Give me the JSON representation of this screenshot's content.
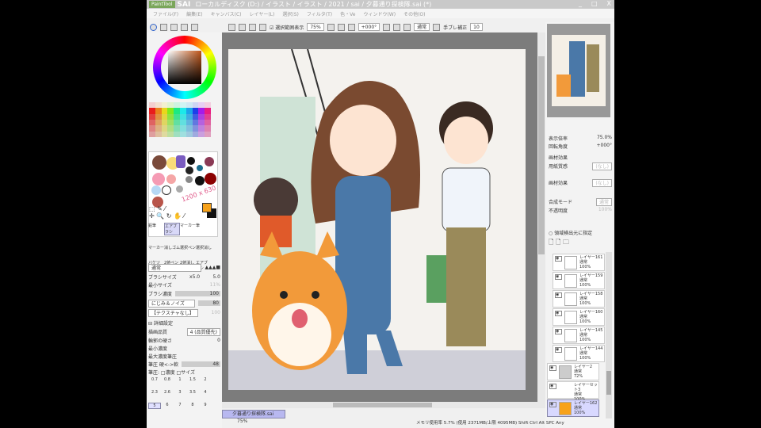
{
  "title": {
    "logo": "PaintTool",
    "app": "SAI",
    "path": "ローカルディスク (D:) / イラスト / イラスト / 2021 / sai / 夕暮通り探検隊.sai (*)",
    "min": "_",
    "max": "□",
    "close": "X"
  },
  "menu": [
    "ファイル(F)",
    "編集(E)",
    "キャンバス(C)",
    "レイヤー(L)",
    "選択(S)",
    "フィルタ(T)",
    "色・Ve",
    "ウィンドウ(W)",
    "その他(O)"
  ],
  "toolbar": {
    "selection_label": "選択範囲表示",
    "zoom": "75%",
    "angle": "+000°",
    "mode": "通常",
    "stabilizer_label": "手ブレ補正",
    "stabilizer": "10"
  },
  "colors": {
    "main": "#f7a21b",
    "sub": "#111111",
    "accent": "#b8b8f0"
  },
  "scratch_note": "1200 x 630",
  "tools": [
    "鉛筆",
    "エアブラシ",
    "マーカー",
    "筆",
    "マーカー",
    "消しゴム",
    "選択ペン",
    "選択消し",
    "バケツ",
    "2値ペン",
    "2値消し",
    "エアブラシ"
  ],
  "brush": {
    "blend": "通常",
    "size_label": "ブラシサイズ",
    "size_mult": "x5.0",
    "size": "5.0",
    "min_size_label": "最小サイズ",
    "min_size": "11%",
    "density_label": "ブラシ濃度",
    "density": "100",
    "noise_label": "にじみ＆ノイズ",
    "noise_val": "80",
    "texture_label": "【テクスチャなし】",
    "texture_val": "100",
    "detail_label": "詳細設定",
    "quality_label": "描画品質",
    "quality": "4 (品質優先)",
    "edge_label": "輪郭の硬さ",
    "edge": "0",
    "min_density_label": "最小濃度",
    "max_pressure_label": "最大濃度筆圧",
    "pressure_label": "筆圧 硬<->軟",
    "pressure": "48",
    "pressure_opts": "筆圧: □濃度 □サイズ"
  },
  "brush_sizes": [
    "0.7",
    "0.8",
    "1",
    "1.5",
    "2",
    "2.3",
    "2.6",
    "3",
    "3.5",
    "4",
    "5",
    "6",
    "7",
    "8",
    "9"
  ],
  "canvas_tab": {
    "name": "夕暮通り探検隊.sai",
    "zoom": "75%"
  },
  "right": {
    "zoom_label": "表示倍率",
    "zoom": "75.0%",
    "angle_label": "回転角度",
    "angle": "+000°",
    "effects_label": "画材効果",
    "paper_label": "用紙質感",
    "paper": "(なし)",
    "effect_label": "画材効果",
    "effect": "(なし)",
    "blend_label": "合成モード",
    "blend": "通常",
    "opacity_label": "不透明度",
    "opacity": "100%",
    "source_label": "領域検出元に指定"
  },
  "layers": [
    {
      "name": "レイヤー161",
      "mode": "通常",
      "opacity": "100%"
    },
    {
      "name": "レイヤー159",
      "mode": "通常",
      "opacity": "100%"
    },
    {
      "name": "レイヤー158",
      "mode": "通常",
      "opacity": "100%"
    },
    {
      "name": "レイヤー160",
      "mode": "通常",
      "opacity": "100%"
    },
    {
      "name": "レイヤー145",
      "mode": "通常",
      "opacity": "100%"
    },
    {
      "name": "レイヤー144",
      "mode": "通常",
      "opacity": "100%"
    },
    {
      "name": "レイヤー2",
      "mode": "通常",
      "opacity": "72%"
    },
    {
      "name": "レイヤーセット3",
      "mode": "通常",
      "opacity": "100%"
    },
    {
      "name": "レイヤー162",
      "mode": "通常",
      "opacity": "100%"
    }
  ],
  "status": "メモリ使用率 5.7% (使用 2371MB/上限 4095MB)   Shift Ctrl Alt SPC Any"
}
